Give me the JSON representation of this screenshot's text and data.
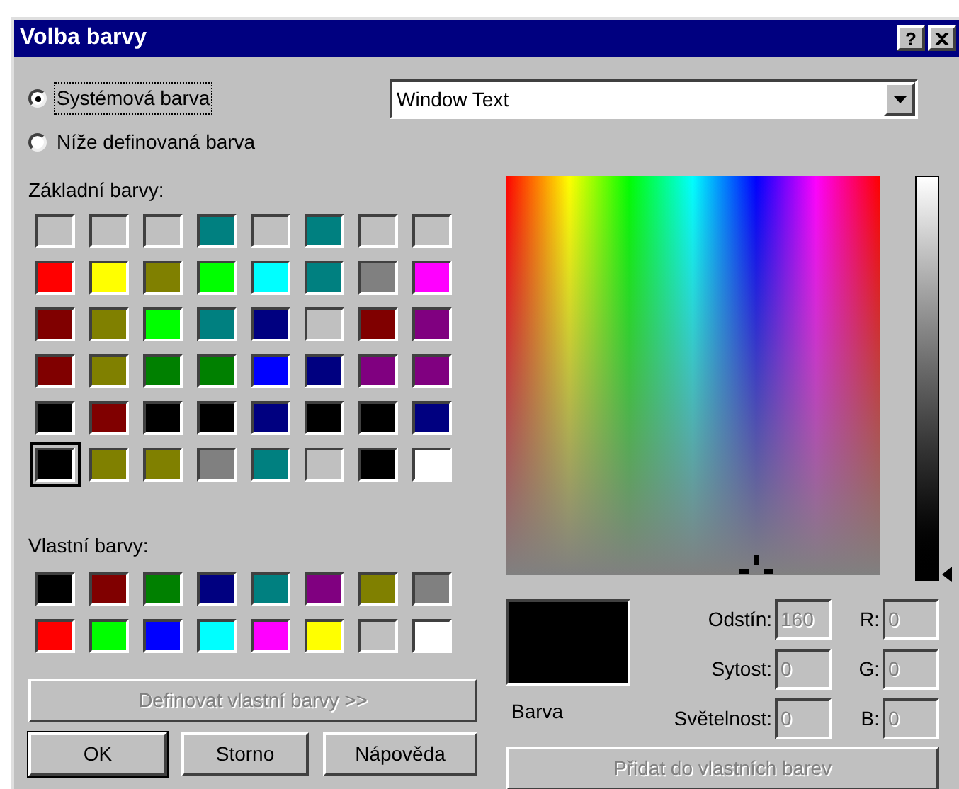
{
  "window": {
    "title": "Volba barvy",
    "help_label": "?"
  },
  "source_options": [
    {
      "label": "Systémová barva",
      "selected": true
    },
    {
      "label": "Níže definovaná barva",
      "selected": false
    }
  ],
  "system_color": {
    "value": "Window Text"
  },
  "basic_colors": {
    "label": "Základní barvy:",
    "swatches": [
      {
        "color": "#c0c0c0",
        "selected": false
      },
      {
        "color": "#c0c0c0",
        "selected": false
      },
      {
        "color": "#c0c0c0",
        "selected": false
      },
      {
        "color": "#008080",
        "selected": false
      },
      {
        "color": "#c0c0c0",
        "selected": false
      },
      {
        "color": "#008080",
        "selected": false
      },
      {
        "color": "#c0c0c0",
        "selected": false
      },
      {
        "color": "#c0c0c0",
        "selected": false
      },
      {
        "color": "#ff0000",
        "selected": false
      },
      {
        "color": "#ffff00",
        "selected": false
      },
      {
        "color": "#808000",
        "selected": false
      },
      {
        "color": "#00ff00",
        "selected": false
      },
      {
        "color": "#00ffff",
        "selected": false
      },
      {
        "color": "#008080",
        "selected": false
      },
      {
        "color": "#808080",
        "selected": false
      },
      {
        "color": "#ff00ff",
        "selected": false
      },
      {
        "color": "#800000",
        "selected": false
      },
      {
        "color": "#808000",
        "selected": false
      },
      {
        "color": "#00ff00",
        "selected": false
      },
      {
        "color": "#008080",
        "selected": false
      },
      {
        "color": "#000080",
        "selected": false
      },
      {
        "color": "#c0c0c0",
        "selected": false
      },
      {
        "color": "#800000",
        "selected": false
      },
      {
        "color": "#800080",
        "selected": false
      },
      {
        "color": "#800000",
        "selected": false
      },
      {
        "color": "#808000",
        "selected": false
      },
      {
        "color": "#008000",
        "selected": false
      },
      {
        "color": "#008000",
        "selected": false
      },
      {
        "color": "#0000ff",
        "selected": false
      },
      {
        "color": "#000080",
        "selected": false
      },
      {
        "color": "#800080",
        "selected": false
      },
      {
        "color": "#800080",
        "selected": false
      },
      {
        "color": "#000000",
        "selected": false
      },
      {
        "color": "#800000",
        "selected": false
      },
      {
        "color": "#000000",
        "selected": false
      },
      {
        "color": "#000000",
        "selected": false
      },
      {
        "color": "#000080",
        "selected": false
      },
      {
        "color": "#000000",
        "selected": false
      },
      {
        "color": "#000000",
        "selected": false
      },
      {
        "color": "#000080",
        "selected": false
      },
      {
        "color": "#000000",
        "selected": true
      },
      {
        "color": "#808000",
        "selected": false
      },
      {
        "color": "#808000",
        "selected": false
      },
      {
        "color": "#808080",
        "selected": false
      },
      {
        "color": "#008080",
        "selected": false
      },
      {
        "color": "#c0c0c0",
        "selected": false
      },
      {
        "color": "#000000",
        "selected": false
      },
      {
        "color": "#ffffff",
        "selected": false
      }
    ]
  },
  "custom_colors": {
    "label": "Vlastní barvy:",
    "swatches": [
      {
        "color": "#000000",
        "selected": false
      },
      {
        "color": "#800000",
        "selected": false
      },
      {
        "color": "#008000",
        "selected": false
      },
      {
        "color": "#000080",
        "selected": false
      },
      {
        "color": "#008080",
        "selected": false
      },
      {
        "color": "#800080",
        "selected": false
      },
      {
        "color": "#808000",
        "selected": false
      },
      {
        "color": "#808080",
        "selected": false
      },
      {
        "color": "#ff0000",
        "selected": false
      },
      {
        "color": "#00ff00",
        "selected": false
      },
      {
        "color": "#0000ff",
        "selected": false
      },
      {
        "color": "#00ffff",
        "selected": false
      },
      {
        "color": "#ff00ff",
        "selected": false
      },
      {
        "color": "#ffff00",
        "selected": false
      },
      {
        "color": "#c0c0c0",
        "selected": false
      },
      {
        "color": "#ffffff",
        "selected": false
      }
    ]
  },
  "define_button": {
    "label": "Definovat vlastní barvy >>",
    "disabled": true
  },
  "dialog_buttons": [
    {
      "label": "OK",
      "default": true
    },
    {
      "label": "Storno",
      "default": false
    },
    {
      "label": "Nápověda",
      "default": false
    }
  ],
  "preview": {
    "label": "Barva",
    "color": "#000000"
  },
  "hsl_fields": [
    {
      "label": "Odstín:",
      "value": "160",
      "disabled": true
    },
    {
      "label": "Sytost:",
      "value": "0",
      "disabled": true
    },
    {
      "label": "Světelnost:",
      "value": "0",
      "disabled": true
    }
  ],
  "rgb_fields": [
    {
      "label": "R:",
      "value": "0",
      "disabled": true
    },
    {
      "label": "G:",
      "value": "0",
      "disabled": true
    },
    {
      "label": "B:",
      "value": "0",
      "disabled": true
    }
  ],
  "add_button": {
    "label": "Přidat do vlastních barev",
    "disabled": true
  }
}
